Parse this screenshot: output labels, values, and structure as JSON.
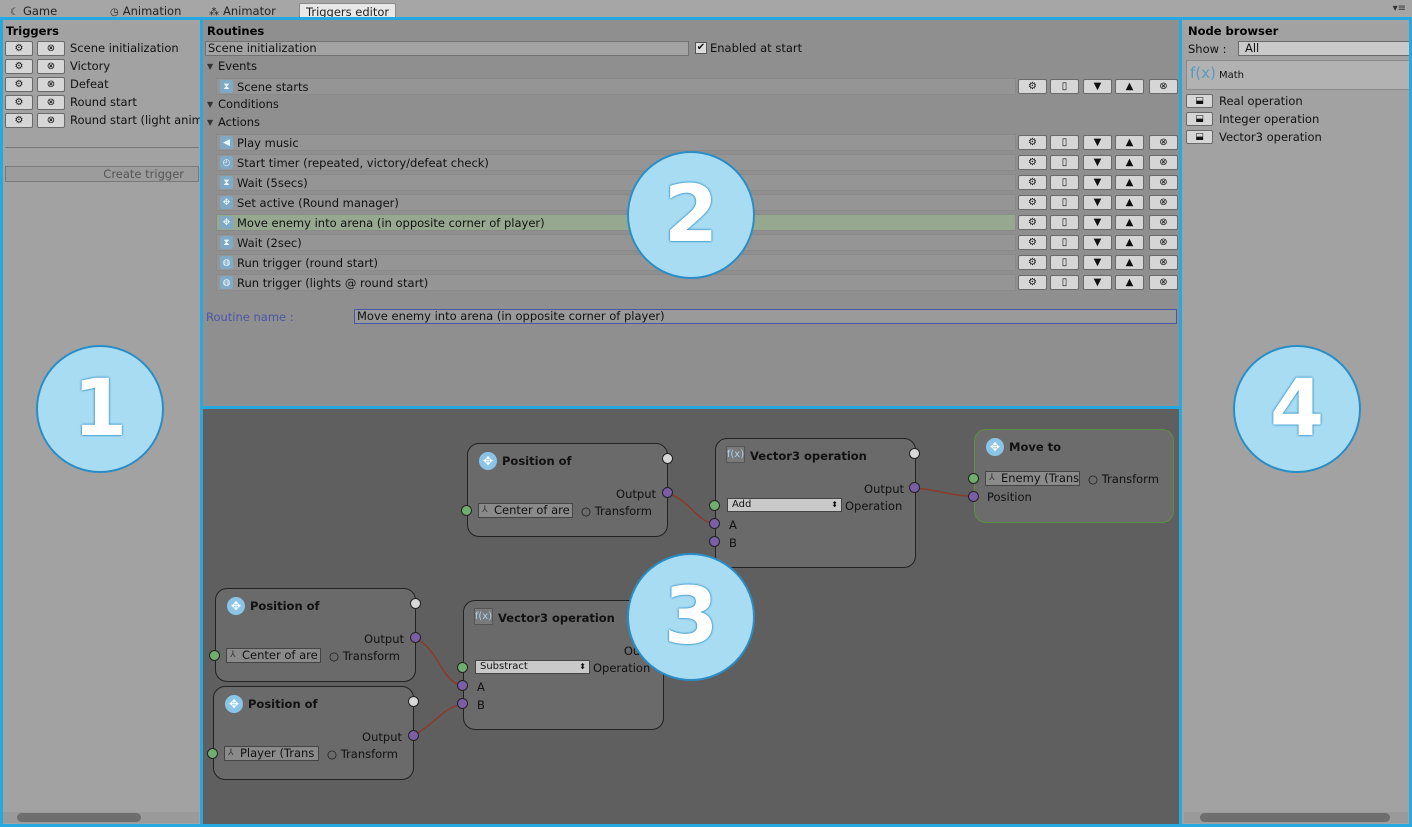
{
  "tabs": [
    {
      "label": "Game",
      "icon": "game-icon"
    },
    {
      "label": "Animation",
      "icon": "clock-icon"
    },
    {
      "label": "Animator",
      "icon": "animator-icon"
    },
    {
      "label": "Triggers editor",
      "icon": ""
    }
  ],
  "triggers": {
    "title": "Triggers",
    "items": [
      "Scene initialization",
      "Victory",
      "Defeat",
      "Round start",
      "Round start (light anim"
    ],
    "create_label": "Create trigger"
  },
  "routines": {
    "title": "Routines",
    "name_value": "Scene initialization",
    "enabled_label": "Enabled at start",
    "enabled_checked": true,
    "events_label": "Events",
    "conditions_label": "Conditions",
    "actions_label": "Actions",
    "events": [
      {
        "label": "Scene starts",
        "icon": "hourglass-icon"
      }
    ],
    "actions": [
      {
        "label": "Play music",
        "icon": "speaker-icon"
      },
      {
        "label": "Start timer (repeated, victory/defeat check)",
        "icon": "timer-icon"
      },
      {
        "label": "Wait (5secs)",
        "icon": "hourglass-icon"
      },
      {
        "label": "Set active (Round manager)",
        "icon": "move-icon"
      },
      {
        "label": "Move enemy into arena (in opposite corner of player)",
        "icon": "move-icon",
        "selected": true
      },
      {
        "label": "Wait (2sec)",
        "icon": "hourglass-icon"
      },
      {
        "label": "Run trigger (round start)",
        "icon": "trigger-icon"
      },
      {
        "label": "Run trigger (lights @ round start)",
        "icon": "trigger-icon"
      }
    ],
    "routine_name_label": "Routine name :",
    "routine_name_value": "Move enemy into arena (in opposite corner of player)"
  },
  "graph": {
    "nodes": {
      "pos1": {
        "title": "Position of",
        "output": "Output",
        "field": "Center of are",
        "type": "Transform"
      },
      "v3op1": {
        "title": "Vector3 operation",
        "output": "Output",
        "op": "Add",
        "op_label": "Operation",
        "a": "A",
        "b": "B"
      },
      "moveto": {
        "title": "Move to",
        "field": "Enemy (Trans",
        "type": "Transform",
        "position": "Position"
      },
      "pos2": {
        "title": "Position of",
        "output": "Output",
        "field": "Center of are",
        "type": "Transform"
      },
      "pos3": {
        "title": "Position of",
        "output": "Output",
        "field": "Player (Trans",
        "type": "Transform"
      },
      "v3op2": {
        "title": "Vector3 operation",
        "output": "Outp",
        "op": "Substract",
        "op_label": "Operation",
        "a": "A",
        "b": "B"
      }
    }
  },
  "node_browser": {
    "title": "Node browser",
    "show_label": "Show :",
    "show_value": "All",
    "category": "Math",
    "category_icon": "f(x)",
    "items": [
      "Real operation",
      "Integer operation",
      "Vector3 operation"
    ]
  },
  "callouts": [
    "1",
    "2",
    "3",
    "4"
  ],
  "colors": {
    "frame": "#26a9e0",
    "bubble": "#a8dcf2",
    "selected_row": "#96a88f"
  }
}
